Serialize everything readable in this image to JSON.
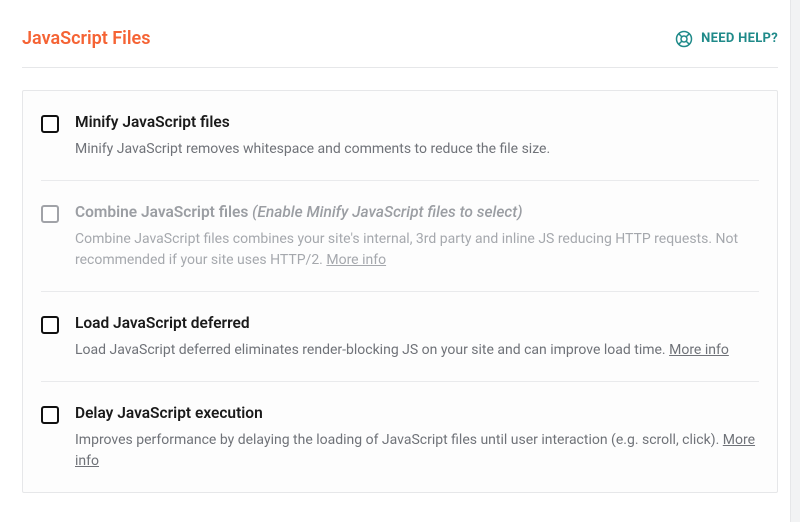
{
  "header": {
    "title": "JavaScript Files",
    "help_label": "NEED HELP?"
  },
  "options": {
    "minify": {
      "title": "Minify JavaScript files",
      "desc": "Minify JavaScript removes whitespace and comments to reduce the file size."
    },
    "combine": {
      "title": "Combine JavaScript files ",
      "hint": "(Enable Minify JavaScript files to select)",
      "desc": "Combine JavaScript files combines your site's internal, 3rd party and inline JS reducing HTTP requests. Not recommended if your site uses HTTP/2. ",
      "more": "More info"
    },
    "defer": {
      "title": "Load JavaScript deferred",
      "desc": "Load JavaScript deferred eliminates render-blocking JS on your site and can improve load time. ",
      "more": "More info"
    },
    "delay": {
      "title": "Delay JavaScript execution",
      "desc": "Improves performance by delaying the loading of JavaScript files until user interaction (e.g. scroll, click). ",
      "more": "More info"
    }
  }
}
